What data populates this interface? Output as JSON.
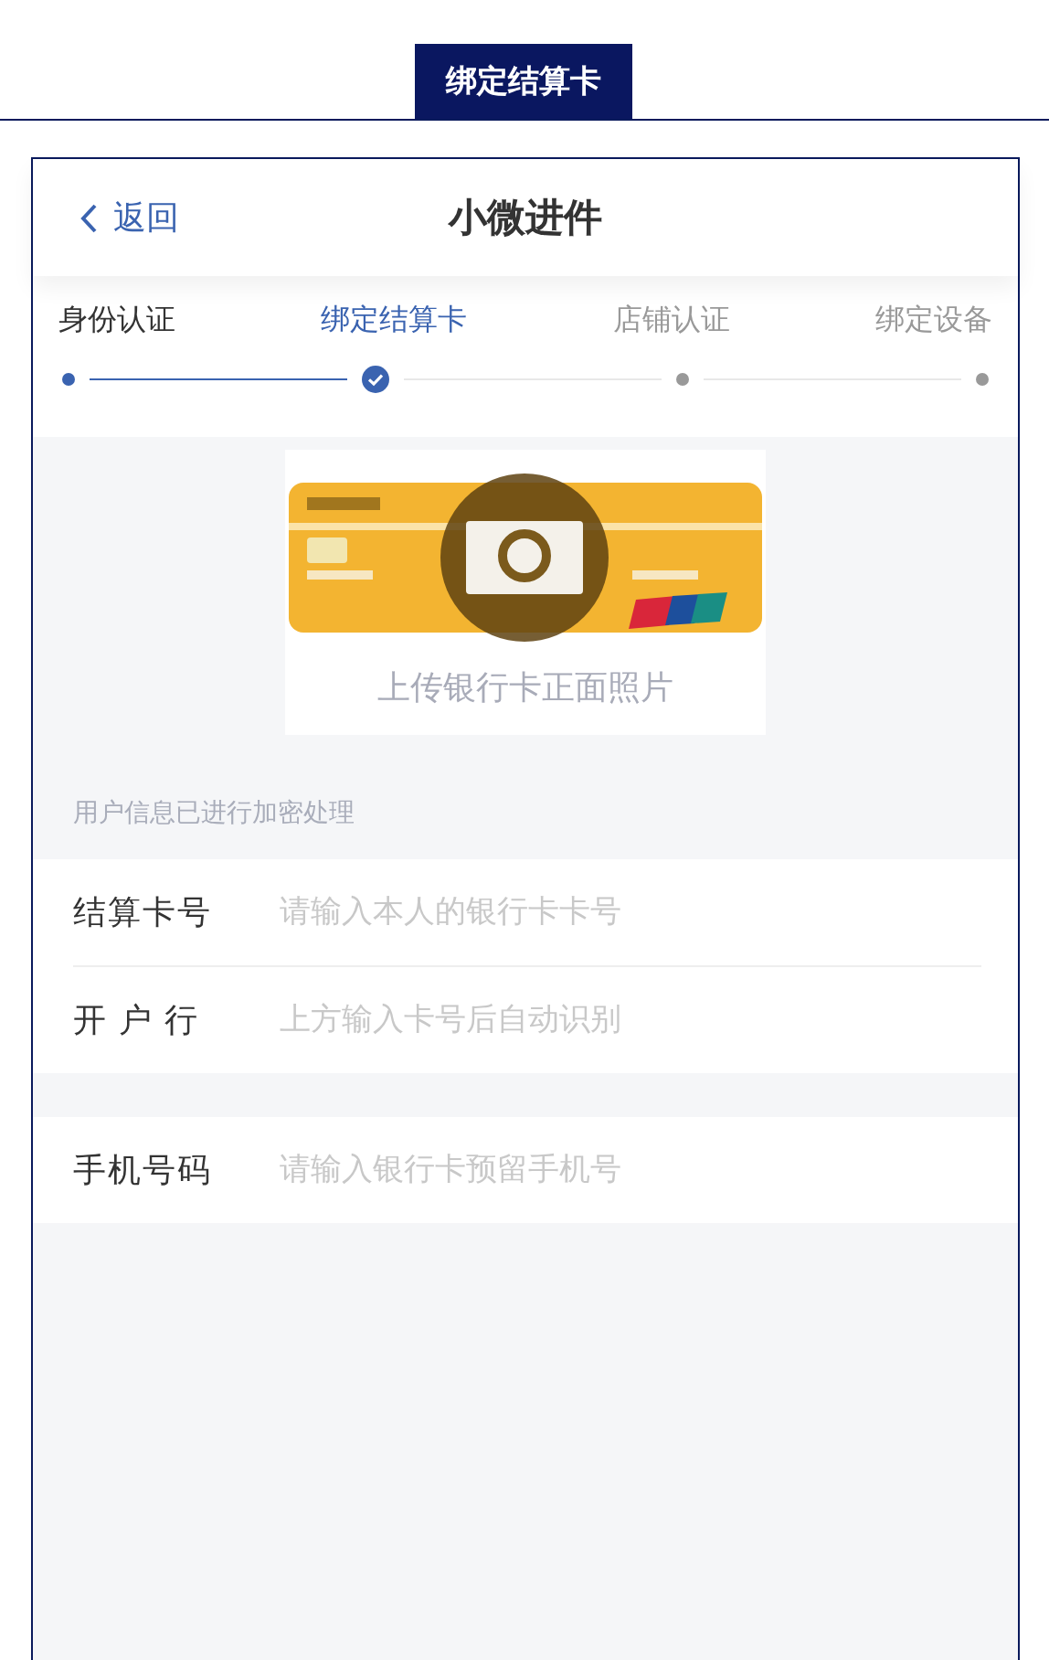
{
  "header_tab": {
    "label": "绑定结算卡"
  },
  "nav": {
    "back": "返回",
    "title": "小微进件"
  },
  "steps": [
    {
      "label": "身份认证",
      "done": true,
      "selected": false
    },
    {
      "label": "绑定结算卡",
      "done": true,
      "selected": true
    },
    {
      "label": "店铺认证",
      "done": false,
      "selected": false
    },
    {
      "label": "绑定设备",
      "done": false,
      "selected": false
    }
  ],
  "upload": {
    "kind": "picture",
    "caption": "上传银行卡正面照片"
  },
  "note": "用户信息已进行加密处理",
  "form_groups": [
    {
      "fields": [
        {
          "label": "结算卡号",
          "placeholder": "请输入本人的银行卡卡号"
        },
        {
          "label": "开 户 行",
          "placeholder": "上方输入卡号后自动识别"
        }
      ]
    },
    {
      "fields": [
        {
          "label": "手机号码",
          "placeholder": "请输入银行卡预留手机号"
        }
      ]
    }
  ]
}
